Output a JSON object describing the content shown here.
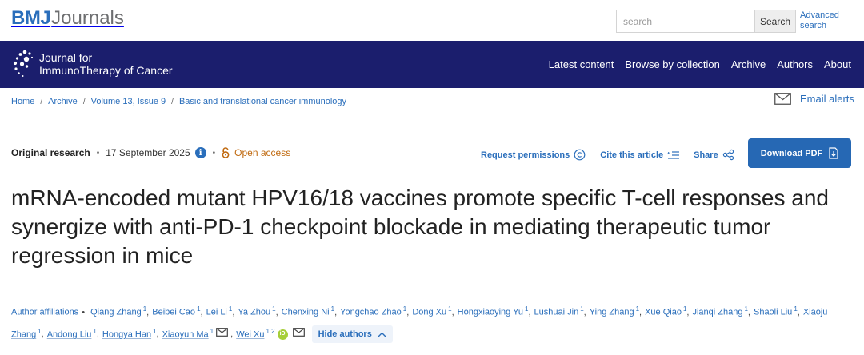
{
  "header": {
    "brand_bmj": "BMJ",
    "brand_journals": "Journals",
    "search_placeholder": "search",
    "search_button": "Search",
    "advanced_search": "Advanced search"
  },
  "journal_nav": {
    "journal_line1": "Journal for",
    "journal_line2": "ImmunoTherapy of Cancer",
    "links": [
      "Latest content",
      "Browse by collection",
      "Archive",
      "Authors",
      "About"
    ]
  },
  "breadcrumb": [
    "Home",
    "Archive",
    "Volume 13, Issue 9",
    "Basic and translational cancer immunology"
  ],
  "email_alerts": "Email alerts",
  "meta": {
    "article_type": "Original research",
    "date": "17 September 2025",
    "access": "Open access"
  },
  "actions": {
    "request_permissions": "Request permissions",
    "cite": "Cite this article",
    "share": "Share",
    "download": "Download PDF"
  },
  "title": "mRNA-encoded mutant HPV16/18 vaccines promote specific T-cell responses and synergize with anti-PD-1 checkpoint blockade in mediating therapeutic tumor regression in mice",
  "authors": {
    "affiliations_label": "Author affiliations",
    "list": [
      {
        "name": "Qiang Zhang",
        "sup": "1"
      },
      {
        "name": "Beibei Cao",
        "sup": "1"
      },
      {
        "name": "Lei Li",
        "sup": "1"
      },
      {
        "name": "Ya Zhou",
        "sup": "1"
      },
      {
        "name": "Chenxing Ni",
        "sup": "1"
      },
      {
        "name": "Yongchao Zhao",
        "sup": "1"
      },
      {
        "name": "Dong Xu",
        "sup": "1"
      },
      {
        "name": "Hongxiaoying Yu",
        "sup": "1"
      },
      {
        "name": "Lushuai Jin",
        "sup": "1"
      },
      {
        "name": "Ying Zhang",
        "sup": "1"
      },
      {
        "name": "Xue Qiao",
        "sup": "1"
      },
      {
        "name": "Jianqi Zhang",
        "sup": "1"
      },
      {
        "name": "Shaoli Liu",
        "sup": "1"
      },
      {
        "name": "Xiaoju Zhang",
        "sup": "1"
      },
      {
        "name": "Andong Liu",
        "sup": "1"
      },
      {
        "name": "Hongya Han",
        "sup": "1"
      },
      {
        "name": "Xiaoyun Ma",
        "sup": "1"
      },
      {
        "name": "Wei Xu",
        "sup": "1 2"
      }
    ],
    "hide_label": "Hide authors"
  },
  "colors": {
    "brand_blue": "#2a6ebb",
    "nav_bg": "#1b1e6d",
    "open_access": "#c06a10",
    "download_bg": "#2668b4",
    "orcid": "#a6ce39"
  }
}
